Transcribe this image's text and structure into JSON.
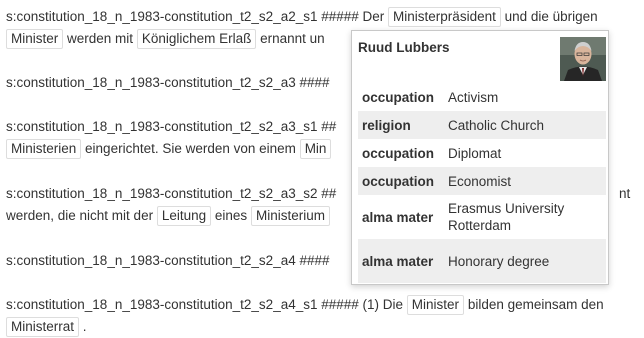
{
  "document": {
    "p1": {
      "prefix": "s:constitution_18_n_1983-constitution_t2_s2_a2_s1 ##### Der",
      "tag1": "Ministerpräsident",
      "text1": "und die übrigen",
      "tag2": "Minister",
      "text2": "werden mit",
      "tag3": "Königlichem Erlaß",
      "text3": "ernannt un"
    },
    "p2": {
      "prefix": "s:constitution_18_n_1983-constitution_t2_s2_a3 ####"
    },
    "p3": {
      "prefix": "s:constitution_18_n_1983-constitution_t2_s2_a3_s1 ##",
      "tag1": "Ministerien",
      "text1": "eingerichtet. Sie werden von einem",
      "tag2": "Min"
    },
    "p4": {
      "prefix": "s:constitution_18_n_1983-constitution_t2_s2_a3_s2 ##",
      "tail": "nt",
      "text1": "werden, die nicht mit der",
      "tag1": "Leitung",
      "text2": "eines",
      "tag2": "Ministerium"
    },
    "p5": {
      "prefix": "s:constitution_18_n_1983-constitution_t2_s2_a4 ####"
    },
    "p6": {
      "prefix": "s:constitution_18_n_1983-constitution_t2_s2_a4_s1 ##### (1) Die",
      "tag1": "Minister",
      "text1": "bilden gemeinsam den",
      "tag2": "Ministerrat",
      "end": "."
    }
  },
  "popup": {
    "name": "Ruud Lubbers",
    "facts": [
      {
        "key": "occupation",
        "value": "Activism"
      },
      {
        "key": "religion",
        "value": "Catholic Church"
      },
      {
        "key": "occupation",
        "value": "Diplomat"
      },
      {
        "key": "occupation",
        "value": "Economist"
      },
      {
        "key": "alma mater",
        "value": "Erasmus University Rotterdam"
      },
      {
        "key": "alma mater",
        "value": "Honorary degree"
      }
    ]
  }
}
